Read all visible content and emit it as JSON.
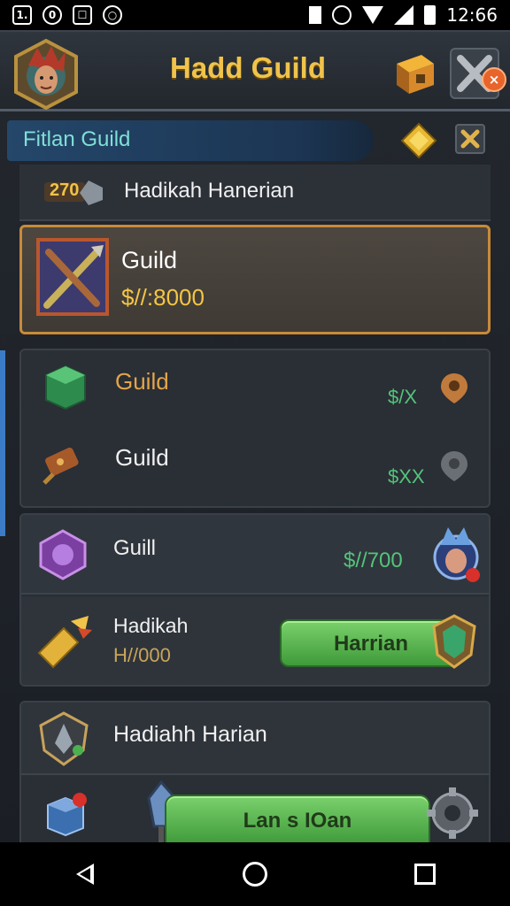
{
  "status_bar": {
    "time": "12:66",
    "left_icons": [
      "notification-icon-1",
      "notification-icon-2",
      "notification-icon-3",
      "notification-icon-4"
    ],
    "left_icon_glyphs": [
      "1.",
      "0",
      "☐",
      "○"
    ]
  },
  "header": {
    "title": "Hadd Guild",
    "notification_badge": "×"
  },
  "subheader": {
    "title": "Fitlan Guild"
  },
  "user_row": {
    "level_text": "270",
    "name": "Hadikah Hanerian"
  },
  "selected_card": {
    "title": "Guild",
    "price": "$//:8000"
  },
  "panel_items": [
    {
      "label": "Guild",
      "value": "$/X",
      "label_color": "#e3a54a"
    },
    {
      "label": "Guild",
      "value": "$XX",
      "label_color": "#f0f0f0"
    }
  ],
  "list_block": {
    "row1": {
      "label": "Guill",
      "price": "$//700"
    },
    "row2": {
      "label": "Hadikah",
      "sublabel": "H//000",
      "button_label": "Harrian"
    }
  },
  "bottom_block": {
    "row1": {
      "label": "Hadiahh Harian"
    },
    "row2": {
      "button_label": "Lan s IOan"
    }
  },
  "colors": {
    "accent_gold": "#f0c34a",
    "selected_border": "#c98a39",
    "green_button": "#5bb54f",
    "price_green": "#53c47b"
  }
}
